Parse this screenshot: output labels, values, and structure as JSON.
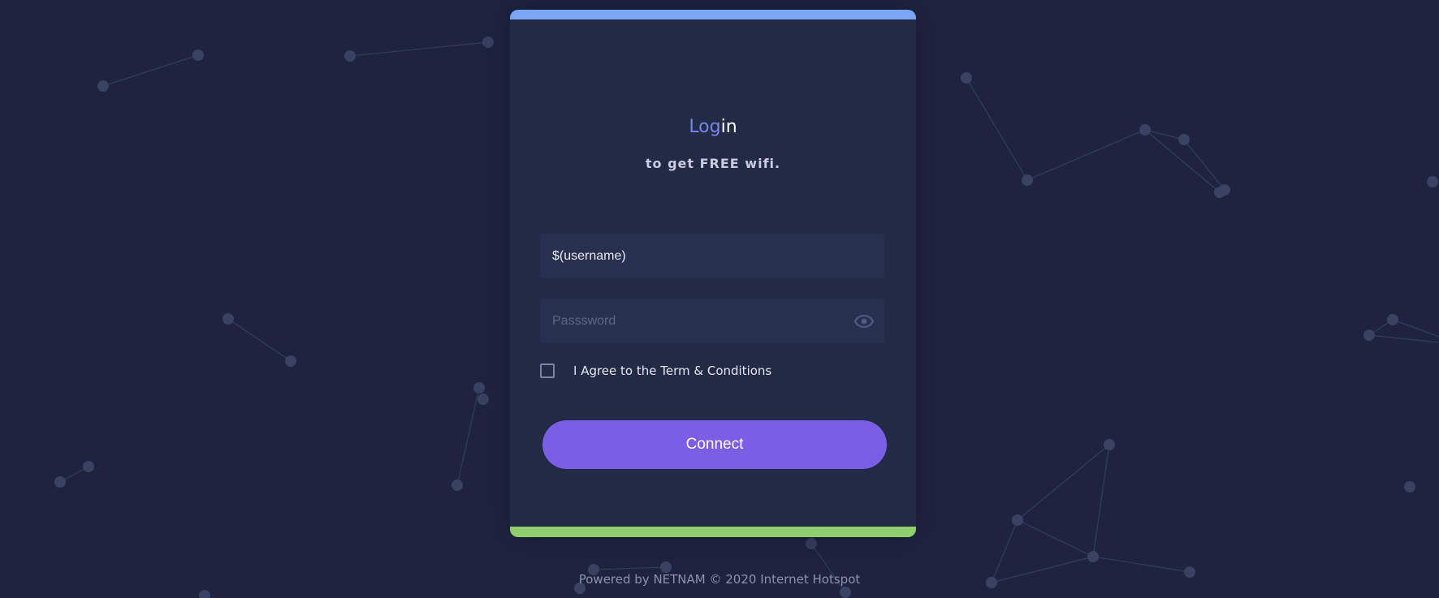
{
  "login": {
    "title_accent": "Log",
    "title_rest": "in",
    "subtitle": "to get FREE wifi."
  },
  "form": {
    "username_value": "$(username)",
    "password_placeholder": "Passsword",
    "agree_label": "I Agree to the Term & Conditions",
    "agree_checked": false,
    "connect_label": "Connect"
  },
  "footer": {
    "text": "Powered by NETNAM © 2020 Internet Hotspot"
  },
  "colors": {
    "background": "#1e2440",
    "card": "#222a45",
    "top_bar": "#7aa6f5",
    "bottom_bar": "#8fd06d",
    "accent": "#7886ec",
    "button": "#7b5ee6"
  },
  "icons": {
    "password_toggle": "eye-icon"
  }
}
